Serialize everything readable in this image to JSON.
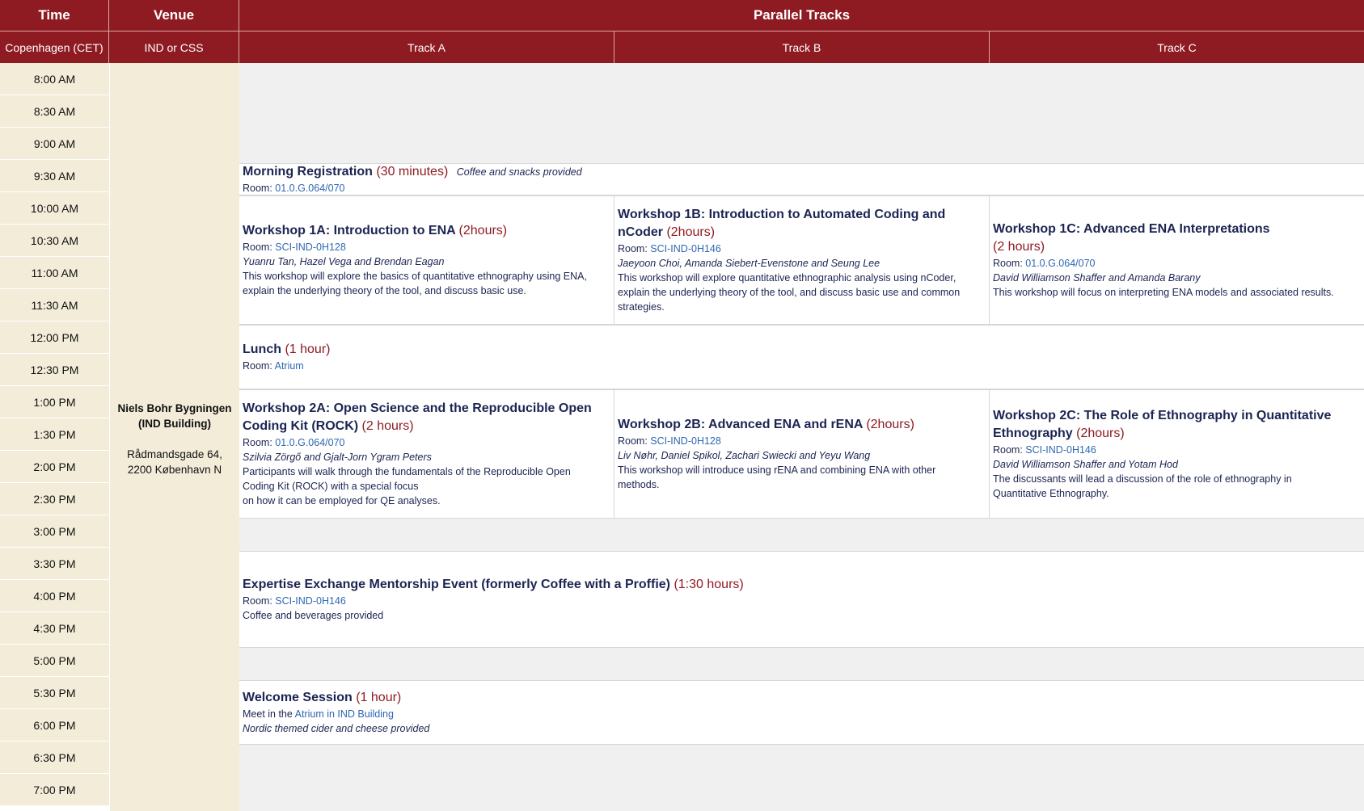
{
  "header": {
    "time": "Time",
    "venue": "Venue",
    "parallel": "Parallel Tracks",
    "time_sub": "Copenhagen (CET)",
    "venue_sub": "IND or CSS",
    "tracks": [
      "Track A",
      "Track B",
      "Track C"
    ]
  },
  "times": [
    "8:00 AM",
    "8:30 AM",
    "9:00 AM",
    "9:30 AM",
    "10:00 AM",
    "10:30 AM",
    "11:00 AM",
    "11:30 AM",
    "12:00 PM",
    "12:30 PM",
    "1:00 PM",
    "1:30 PM",
    "2:00 PM",
    "2:30 PM",
    "3:00 PM",
    "3:30 PM",
    "4:00 PM",
    "4:30 PM",
    "5:00 PM",
    "5:30 PM",
    "6:00 PM",
    "6:30 PM",
    "7:00 PM"
  ],
  "venue": {
    "name_line1": "Niels Bohr Bygningen",
    "name_line2": "(IND Building)",
    "address_line1": "Rådmandsgade 64,",
    "address_line2": "2200 København N"
  },
  "registration": {
    "title": "Morning Registration",
    "duration": "(30 minutes)",
    "note": "Coffee and snacks provided",
    "room_label": "Room: ",
    "room": "01.0.G.064/070"
  },
  "workshops1": [
    {
      "title": "Workshop 1A: Introduction to ENA",
      "duration": "(2hours)",
      "room_label": "Room: ",
      "room": "SCI-IND-0H128",
      "presenters": "Yuanru Tan, Hazel Vega and Brendan Eagan",
      "desc1": "This workshop will explore the basics of quantitative ethnography using ENA,",
      "desc2": "explain the underlying theory of the tool, and discuss basic use.",
      "desc3": ""
    },
    {
      "title": "Workshop 1B: Introduction to Automated Coding and nCoder",
      "duration": "(2hours)",
      "room_label": "Room: ",
      "room": "SCI-IND-0H146",
      "presenters": "Jaeyoon Choi, Amanda Siebert-Evenstone and Seung Lee",
      "desc1": "This workshop will explore quantitative ethnographic analysis using nCoder,",
      "desc2": "explain the underlying theory of the tool, and discuss basic use and common",
      "desc3": "strategies."
    },
    {
      "title": "Workshop 1C: Advanced ENA Interpretations",
      "duration": "(2 hours)",
      "room_label": "Room: ",
      "room": "01.0.G.064/070",
      "presenters": "David Williamson Shaffer and Amanda Barany",
      "desc1": "This workshop will focus on interpreting ENA models and associated results.",
      "desc2": "",
      "desc3": ""
    }
  ],
  "lunch": {
    "title": "Lunch",
    "duration": "(1 hour)",
    "room_label": "Room: ",
    "room": "Atrium"
  },
  "workshops2": [
    {
      "title": "Workshop 2A: Open Science and the Reproducible Open Coding Kit (ROCK)",
      "duration": "(2 hours)",
      "room_label": "Room: ",
      "room": "01.0.G.064/070",
      "presenters": "Szilvia Zörgő and Gjalt-Jorn Ygram Peters",
      "desc1": "Participants will walk through the fundamentals of the Reproducible Open",
      "desc2": "Coding Kit (ROCK) with a special focus",
      "desc3": "on how it can be employed for QE analyses."
    },
    {
      "title": "Workshop 2B: Advanced ENA and rENA",
      "duration": "(2hours)",
      "room_label": "Room: ",
      "room": "SCI-IND-0H128",
      "presenters": "Liv Nøhr, Daniel Spikol, Zachari Swiecki and Yeyu Wang",
      "desc1": "This workshop will introduce using rENA and combining ENA with other",
      "desc2": "methods.",
      "desc3": ""
    },
    {
      "title": "Workshop 2C: The Role of Ethnography in Quantitative Ethnography",
      "duration": "(2hours)",
      "room_label": "Room: ",
      "room": "SCI-IND-0H146",
      "presenters": "David Williamson Shaffer and Yotam Hod",
      "desc1": "The discussants will lead a discussion of the role of ethnography in",
      "desc2": "Quantitative Ethnography.",
      "desc3": ""
    }
  ],
  "mentorship": {
    "title": "Expertise Exchange Mentorship Event (formerly Coffee with a Proffie)",
    "duration": "(1:30 hours)",
    "room_label": "Room: ",
    "room": "SCI-IND-0H146",
    "note": "Coffee and beverages provided"
  },
  "welcome": {
    "title": "Welcome Session",
    "duration": "(1 hour)",
    "meet_label": "Meet in the ",
    "meet_place": "Atrium in IND Building",
    "note": "Nordic themed cider and cheese provided"
  }
}
